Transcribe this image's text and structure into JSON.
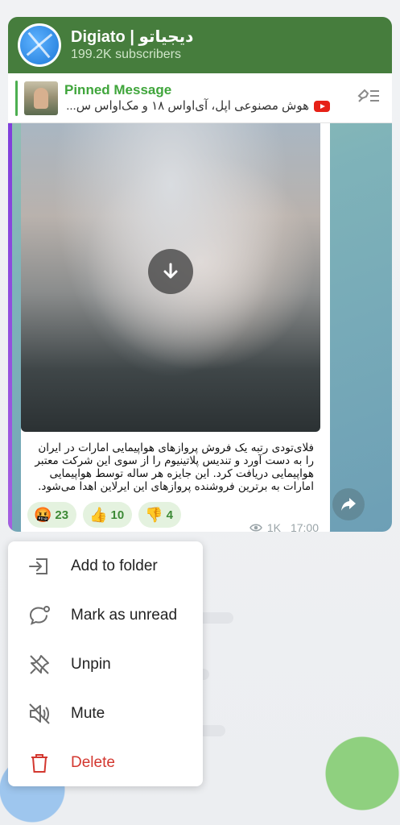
{
  "channel": {
    "title": "Digiato | دیجیاتو",
    "subscribers": "199.2K subscribers"
  },
  "pinned": {
    "title": "Pinned Message",
    "message": "هوش مصنوعی اپل، آی‌اواس ۱۸ و مک‌اواس س..."
  },
  "post": {
    "caption": "فلای‌تودی رتبه یک فروش پروازهای هواپیمایی امارات در ایران را به دست آورد و تندیس پلاتینیوم را از سوی این شرکت معتبر هواپیمایی دریافت کرد. این جایزه هر ساله توسط هواپیمایی امارات به برترین فروشنده پروازهای این ایرلاین اهدا می‌شود.",
    "reactions": [
      {
        "emoji": "🤬",
        "count": "23"
      },
      {
        "emoji": "👍",
        "count": "10"
      },
      {
        "emoji": "👎",
        "count": "4"
      }
    ],
    "views": "1K",
    "time": "17:00"
  },
  "menu": {
    "items": [
      {
        "label": "Add to folder",
        "icon": "add-to-folder-icon"
      },
      {
        "label": "Mark as unread",
        "icon": "mark-unread-icon"
      },
      {
        "label": "Unpin",
        "icon": "unpin-icon"
      },
      {
        "label": "Mute",
        "icon": "mute-icon"
      },
      {
        "label": "Delete",
        "icon": "delete-icon"
      }
    ]
  },
  "colors": {
    "header": "#467d3d",
    "pinned_title": "#3fa53b",
    "delete": "#d3372f",
    "reaction_bg": "#e4f2df"
  }
}
